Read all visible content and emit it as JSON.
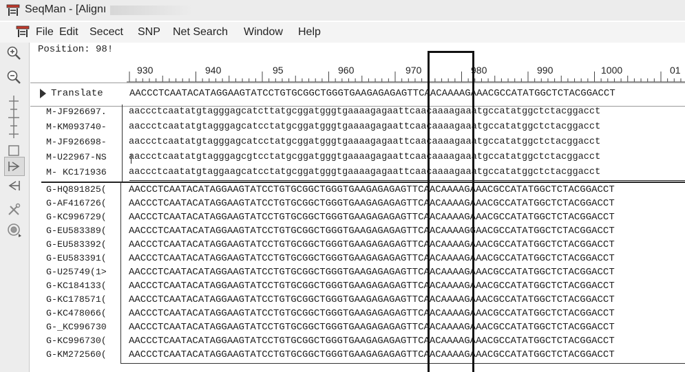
{
  "window": {
    "title": "SeqMan - [Alignı"
  },
  "menu": {
    "items": [
      "File",
      "Edit",
      "Secect",
      "SNP",
      "Net Search",
      "Window",
      "Help"
    ]
  },
  "toolbar": {
    "icons": [
      "zoom-in-icon",
      "zoom-out-icon",
      "dna-structure-icon",
      "select-icon",
      "forward-arrow-icon",
      "back-arrow-icon",
      "tools-icon",
      "target-icon"
    ]
  },
  "alignment": {
    "position_label": "Position: 98!",
    "ruler_ticks": [
      "930",
      "940",
      "95",
      "960",
      "970",
      "980",
      "990",
      "1000",
      "01"
    ],
    "translate": {
      "label": "Translate",
      "sequence": "AACCCTCAATACATAGGAAGTATCCTGTGCGGCTGGGTGAAGAGAGAGTTCAACAAAAGAAACGCCATATGGCTCTACGGACCT"
    },
    "m_rows": [
      {
        "name": "M-JF926697.",
        "seq": "aaccctcaatatgtagggagcatcttatgcggatgggtgaaaagagaattcaacaaaagaaatgccatatggctctacggacct"
      },
      {
        "name": "M-KM093740-",
        "seq": "aaccctcaatatgtagggagcatcctatgcggatgggtgaaaagagaattcaacaaaagaaatgccatatggctctacggacct"
      },
      {
        "name": "M-JF926698-",
        "seq": "aaccctcaatatgtagggagcatcctatgcggatgggtgaaaagagaattcaacaaaagaaatgccatatggctctacggacct"
      },
      {
        "name": "M-U22967-NS",
        "seq": "aaccctcaatatgtagggagcgtcctatgcggatgggtgaaaagagaattcaacaaaagaaatgccatatggctctacggacct"
      },
      {
        "name": "M- KC171936",
        "seq": "aaccctcaatatgtaggaagcatcctatgcggatgggtgaaaagagaattcaacaaaagaaatgccatatggctctacggacct"
      }
    ],
    "g_rows": [
      {
        "name": "G-HQ891825(",
        "seq": "AACCCTCAATACATAGGAAGTATCCTGTGCGGCTGGGTGAAGAGAGAGTTCAACAAAAGAAACGCCATATGGCTCTACGGACCT"
      },
      {
        "name": "G-AF416726(",
        "seq": "AACCCTCAATACATAGGAAGTATCCTGTGCGGCTGGGTGAAGAGAGAGTTCAACAAAAGAAACGCCATATGGCTCTACGGACCT"
      },
      {
        "name": "G-KC996729(",
        "seq": "AACCCTCAATACATAGGAAGTATCCTGTGCGGCTGGGTGAAGAGAGAGTTCAACAAAAGAAACGCCATATGGCTCTACGGACCT"
      },
      {
        "name": "G-EU583389(",
        "seq": "AACCCTCAATACATAGGAAGTATCCTGTGCGGCTGGGTGAAGAGAGAGTTCAACAAAAGGAACGCCATATGGCTCTACGGACCT"
      },
      {
        "name": "G-EU583392(",
        "seq": "AACCCTCAATACATAGGAAGTATCCTGTGCGGCTGGGTGAAGAGAGAGTTCAACAAAAGAAACGCCATATGGCTCTACGGACCT"
      },
      {
        "name": "G-EU583391(",
        "seq": "AACCCTCAATACATAGGAAGTATCCTGTGCGGCTGGGTGAAGAGAGAGTTCAACAAAAGAAACGCCATATGGCTCTACGGACCT"
      },
      {
        "name": "G-U25749(1>",
        "seq": "AACCCTCAATACATAGGAAGTATCCTGTGCGGCTGGGTGAAGAGAGAGTTCAACAAAAGAAACGCCATATGGCTCTACGGACCT"
      },
      {
        "name": "G-KC184133(",
        "seq": "AACCCTCAATACATAGGAAGTATCCTGTGCGGCTGGGTGAAGAGAGAGTTCAACAAAAGAAACGCCATATGGCTCTACGGACCT"
      },
      {
        "name": "G-KC178571(",
        "seq": "AACCCTCAATACATAGGAAGTATCCTGTGCGGCTGGGTGAAGAGAGAGTTCAACAAAAGAAACGCCATATGGCTCTACGGACCT"
      },
      {
        "name": "G-KC478066(",
        "seq": "AACCCTCAATACATAGGAAGTATCCTGTGCGGCTGGGTGAAGAGAGAGTTCAACAAAAGAAACGCCATATGGCTCTACGGACCT"
      },
      {
        "name": "G-_KC996730",
        "seq": "AACCCTCAATACATAGGAAGTATCCTGTGCGGCTGGGTGAAGAGAGAGTTCAACAAAAGAAACGCCATATGGCTCTACGGACCT"
      },
      {
        "name": "G-KC996730(",
        "seq": "AACCCTCAATACATAGGAAGTATCCTGTGCGGCTGGGTGAAGAGAGAGTTCAACAAAAGAAACGCCATATGGCTCTACGGACCT"
      },
      {
        "name": "G-KM272560(",
        "seq": "AACCCTCAATACATAGGAAGTATCCTGTGCGGCTGGGTGAAGAGAGAGTTCAACAAAAGAAACGCCATATGGCTCTACGGACCT"
      }
    ]
  },
  "colors": {
    "titlebar": "#ececec",
    "menubar": "#f4f4f4",
    "toolbar": "#ededed",
    "highlight_box": "#111111"
  }
}
